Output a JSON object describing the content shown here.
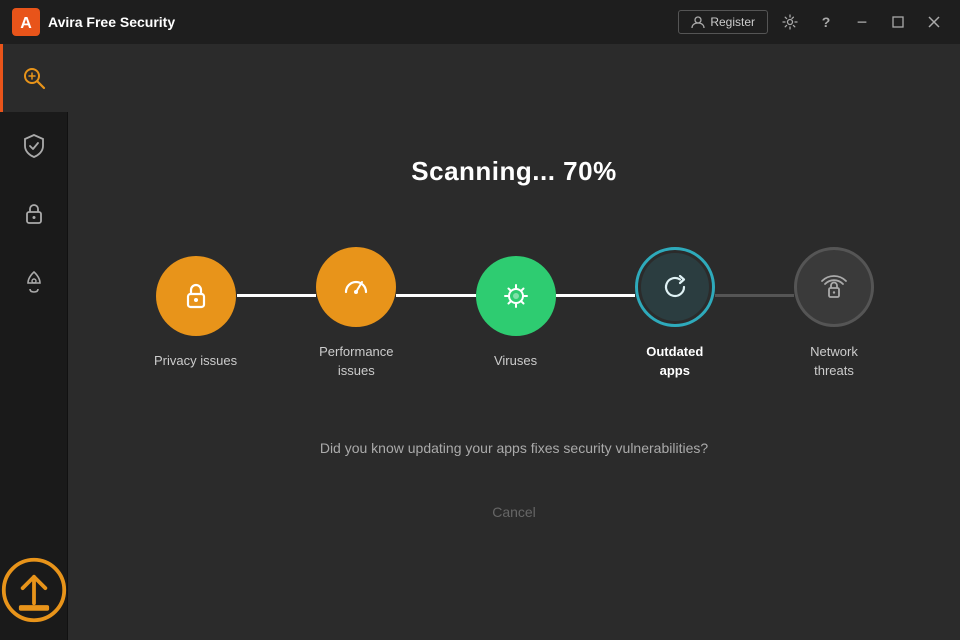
{
  "window": {
    "title_brand": "Avira",
    "title_product": " Free Security"
  },
  "titlebar": {
    "register_label": "Register",
    "settings_tooltip": "Settings",
    "help_tooltip": "Help",
    "minimize_tooltip": "Minimize",
    "restore_tooltip": "Restore",
    "close_tooltip": "Close"
  },
  "sidebar": {
    "items": [
      {
        "id": "scan",
        "icon": "scan-icon",
        "active": true
      },
      {
        "id": "protection",
        "icon": "shield-icon",
        "active": false
      },
      {
        "id": "privacy",
        "icon": "lock-icon",
        "active": false
      },
      {
        "id": "performance",
        "icon": "rocket-icon",
        "active": false
      }
    ],
    "bottom": {
      "id": "upgrade",
      "icon": "upgrade-icon"
    }
  },
  "scan": {
    "title": "Scanning... 70%",
    "steps": [
      {
        "id": "privacy-issues",
        "label": "Privacy issues",
        "state": "done",
        "icon": "lock-shield-icon"
      },
      {
        "id": "performance-issues",
        "label": "Performance\nissues",
        "state": "done",
        "icon": "speedometer-icon"
      },
      {
        "id": "viruses",
        "label": "Viruses",
        "state": "done",
        "icon": "virus-icon"
      },
      {
        "id": "outdated-apps",
        "label": "Outdated\napps",
        "state": "active",
        "icon": "refresh-icon"
      },
      {
        "id": "network-threats",
        "label": "Network\nthreats",
        "state": "pending",
        "icon": "wifi-lock-icon"
      }
    ],
    "info_text": "Did you know updating your apps fixes security vulnerabilities?",
    "cancel_label": "Cancel"
  },
  "colors": {
    "orange": "#e8941a",
    "green": "#2ecc71",
    "teal_border": "#2eaabb",
    "dark_circle": "#3a3a3a",
    "connector_done": "#ffffff",
    "connector_pending": "#555555"
  }
}
